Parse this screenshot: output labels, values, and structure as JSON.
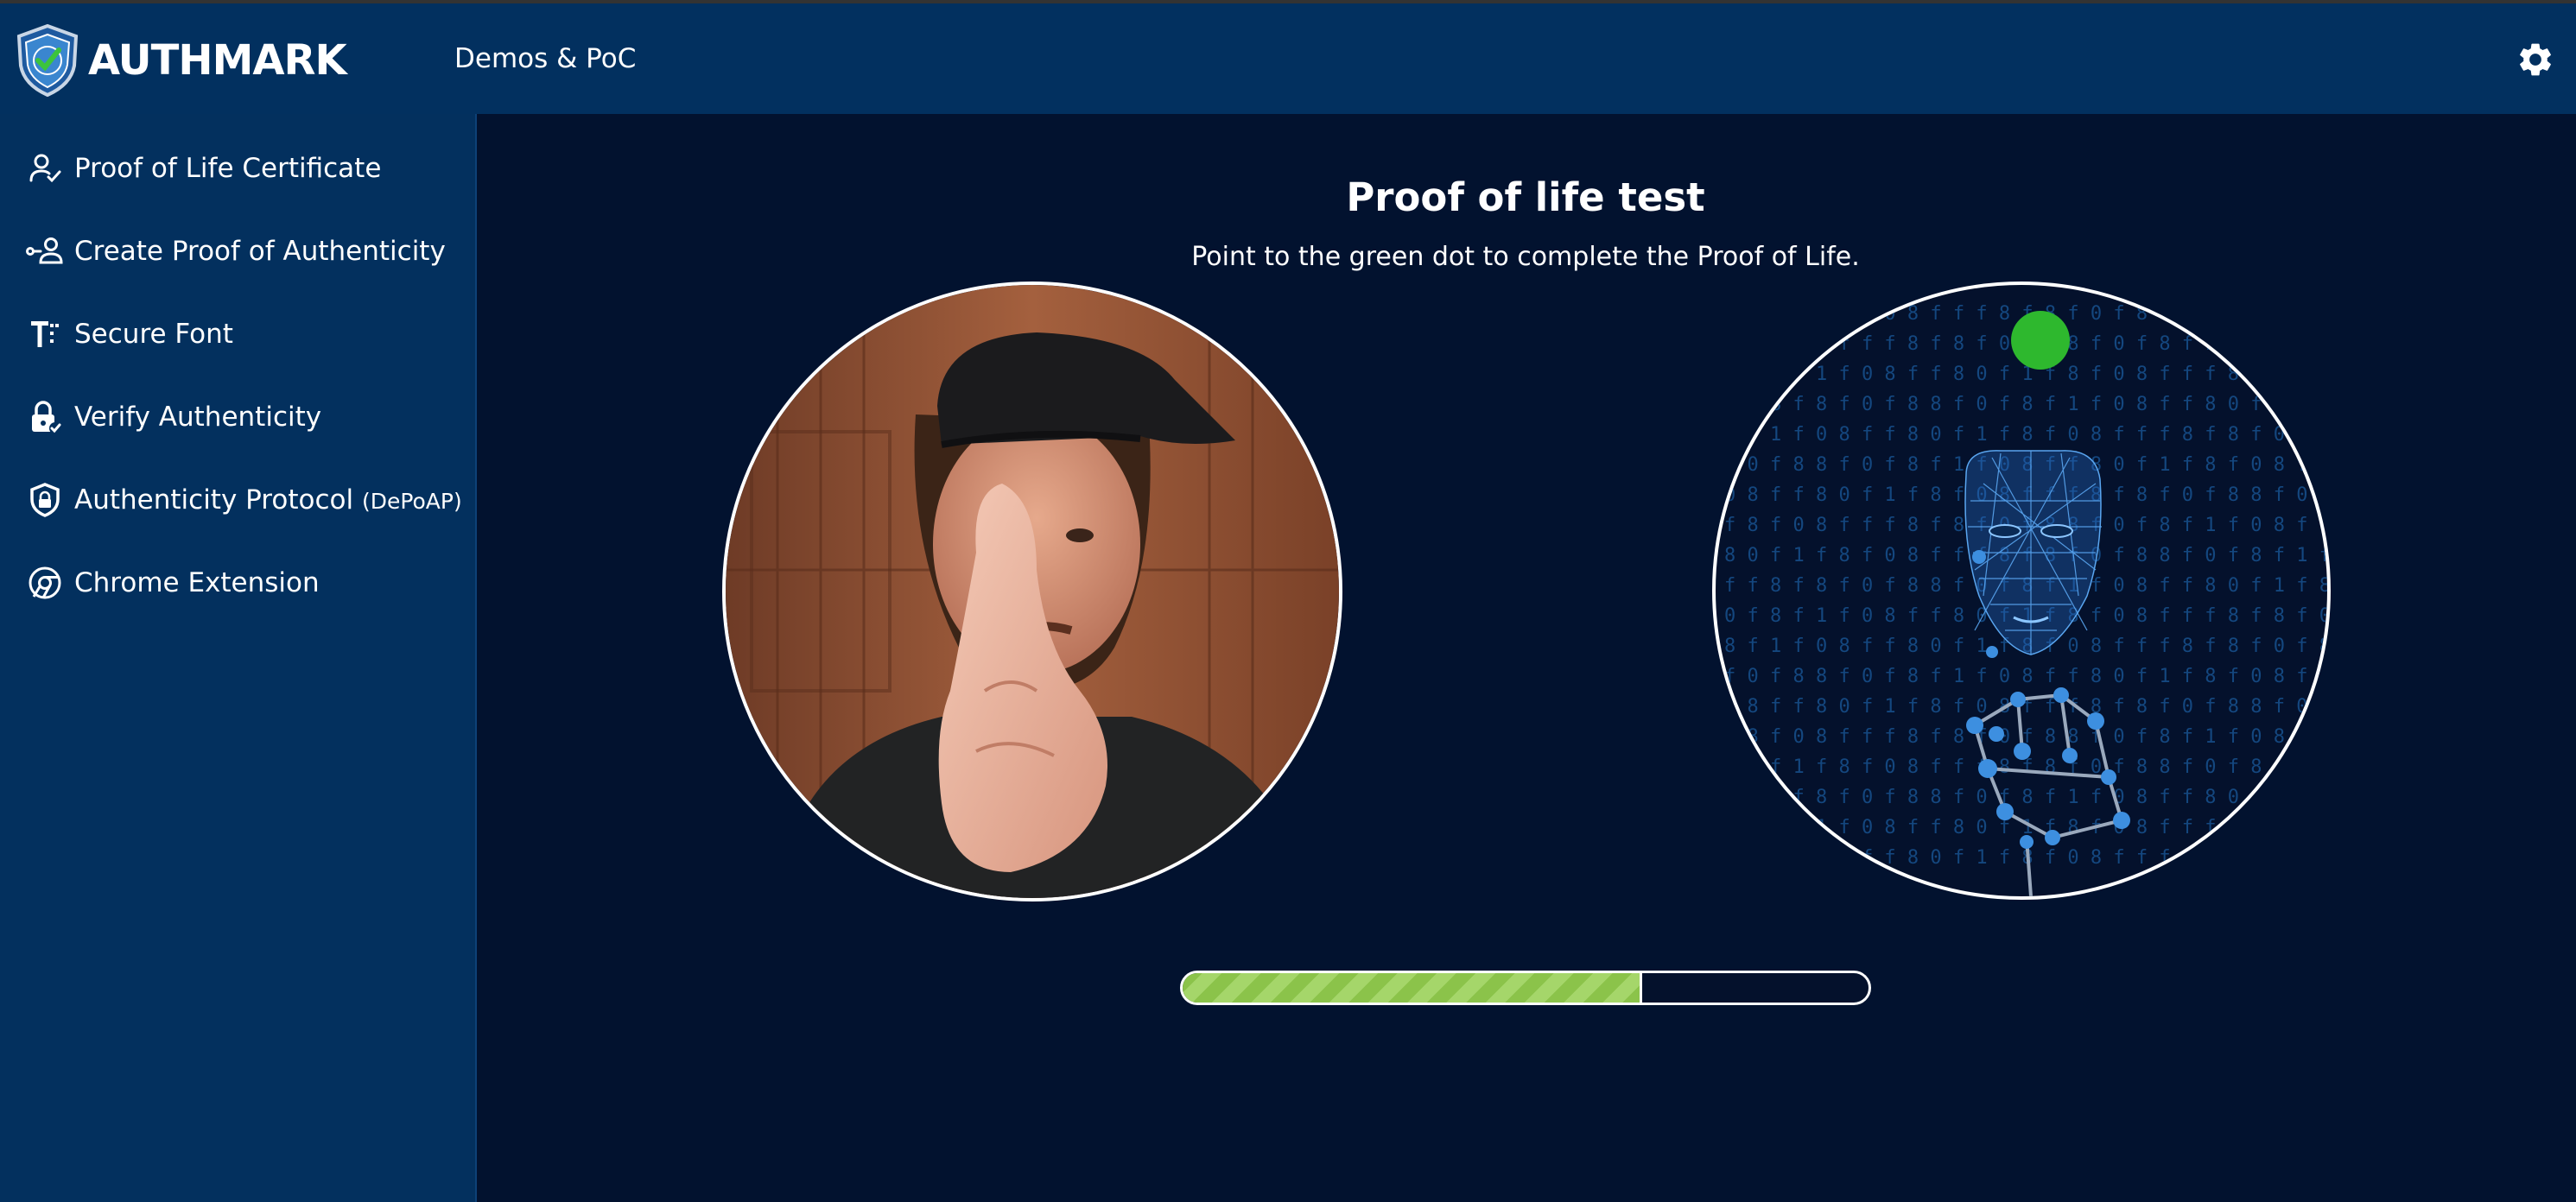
{
  "header": {
    "logo_text": "AUTHMARK",
    "subtitle": "Demos & PoC",
    "settings_icon": "gear-icon"
  },
  "sidebar": {
    "items": [
      {
        "label": "Proof of Life Certificate",
        "icon": "person-check-icon"
      },
      {
        "label": "Create Proof of Authenticity",
        "icon": "person-link-icon"
      },
      {
        "label": "Secure Font",
        "icon": "font-icon"
      },
      {
        "label": "Verify Authenticity",
        "icon": "lock-check-icon"
      },
      {
        "label": "Authenticity Protocol",
        "label_suffix": "(DePoAP)",
        "icon": "shield-lock-icon"
      },
      {
        "label": "Chrome Extension",
        "icon": "chrome-icon"
      }
    ]
  },
  "main": {
    "title": "Proof of life test",
    "instruction": "Point to the green dot to complete the Proof of Life.",
    "progress_percent": 67
  },
  "colors": {
    "header_bg": "#02305f",
    "sidebar_bg": "#03305e",
    "main_bg": "#02122f",
    "target_dot": "#2eb82e",
    "face_mesh": "#3d8fe0",
    "progress_fill": "#8bc34a"
  }
}
